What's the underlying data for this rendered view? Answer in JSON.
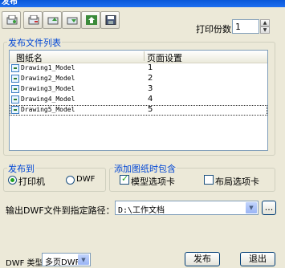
{
  "window": {
    "title": "发布"
  },
  "toolbar": {
    "icons": [
      "add-drawing-icon",
      "remove-drawing-icon",
      "move-up-icon",
      "move-down-icon",
      "load-list-icon",
      "save-list-icon"
    ]
  },
  "copies": {
    "label": "打印份数",
    "value": "1"
  },
  "publish_list": {
    "group_label": "发布文件列表",
    "columns": [
      "图纸名",
      "页面设置"
    ],
    "rows": [
      {
        "name": "Drawing1_Model",
        "layout": "1"
      },
      {
        "name": "Drawing2_Model",
        "layout": "2"
      },
      {
        "name": "Drawing3_Model",
        "layout": "3"
      },
      {
        "name": "Drawing4_Model",
        "layout": "4"
      },
      {
        "name": "Drawing5_Model",
        "layout": "5"
      }
    ]
  },
  "publish_to": {
    "group_label": "发布到",
    "options": [
      "打印机",
      "DWF"
    ],
    "selected": "打印机"
  },
  "include": {
    "group_label": "添加图纸时包含",
    "model_tab": {
      "label": "模型选项卡",
      "checked": true
    },
    "layout_tab": {
      "label": "布局选项卡",
      "checked": false
    }
  },
  "output": {
    "label": "输出DWF文件到指定路径：",
    "path": "D:\\工作文档",
    "browse": "..."
  },
  "dwf_type": {
    "label": "DWF 类型:",
    "value": "多页DWF"
  },
  "buttons": {
    "publish": "发布",
    "exit": "退出"
  },
  "colors": {
    "titlebar": "#0a58d9",
    "group_label": "#0046d5",
    "dialog_bg": "#ece9d8"
  }
}
